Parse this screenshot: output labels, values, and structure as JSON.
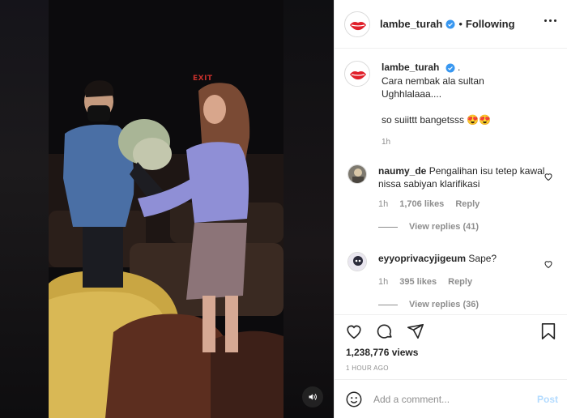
{
  "post": {
    "account": "lambe_turah",
    "follow_state": "Following",
    "caption_lines": [
      "Cara nembak ala sultan",
      "Ughhlalaaa....",
      "",
      "so suiittt bangetsss 😍😍"
    ],
    "caption_age": "1h",
    "views": "1,238,776 views",
    "posted": "1 HOUR AGO"
  },
  "video": {
    "sign_text": "EXIT"
  },
  "comments": [
    {
      "user": "naumy_de",
      "text": "Pengalihan isu tetep kawal nissa sabiyan klarifikasi",
      "age": "1h",
      "likes": "1,706 likes",
      "reply_label": "Reply",
      "replies_label": "View replies (41)"
    },
    {
      "user": "eyyoprivacyjigeum",
      "text": "Sape?",
      "age": "1h",
      "likes": "395 likes",
      "reply_label": "Reply",
      "replies_label": "View replies (36)"
    }
  ],
  "composer": {
    "placeholder": "Add a comment...",
    "post_label": "Post"
  },
  "colors": {
    "verified": "#3897f0",
    "post_disabled": "#b3dbff",
    "muted_text": "#8e8e8e",
    "logo_red": "#e0202a"
  },
  "icons": [
    "verified-badge-icon",
    "more-icon",
    "heart-icon",
    "comment-icon",
    "share-icon",
    "bookmark-icon",
    "emoji-icon",
    "volume-icon"
  ]
}
